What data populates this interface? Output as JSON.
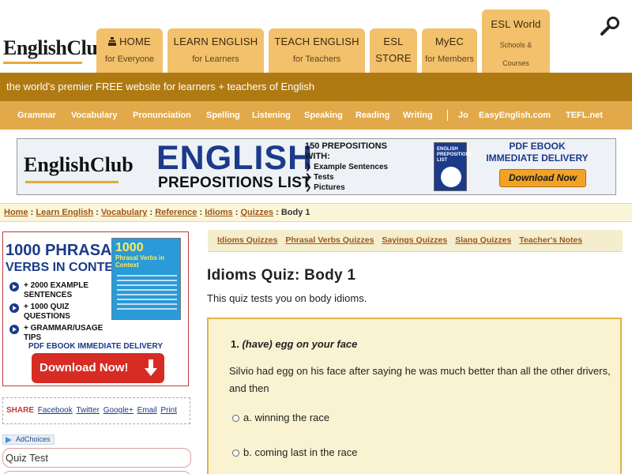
{
  "header": {
    "logo": {
      "english": "English",
      "club": "Club"
    },
    "tabs": [
      {
        "line1": "HOME",
        "line2": "for Everyone"
      },
      {
        "line1": "LEARN ENGLISH",
        "line2": "for Learners"
      },
      {
        "line1": "TEACH ENGLISH",
        "line2": "for Teachers"
      },
      {
        "line1": "ESL",
        "line2": "STORE"
      },
      {
        "line1": "MyEC",
        "line2": "for Members"
      },
      {
        "line1": "ESL World",
        "line2": "Schools &",
        "line3": "Courses"
      }
    ],
    "search_icon": "search-icon",
    "tagline": "the world's premier FREE website for learners + teachers of English",
    "subnav": [
      "Grammar",
      "Vocabulary",
      "Pronunciation",
      "Spelling",
      "Listening",
      "Speaking",
      "Reading",
      "Writing",
      "Jo",
      "EasyEnglish.com",
      "TEFL.net"
    ]
  },
  "banner": {
    "logo": "EnglishClub",
    "title1": "ENGLISH",
    "title2": "PREPOSITIONS LIST",
    "heading1": "150 PREPOSITIONS",
    "heading2": "WITH:",
    "items": [
      "Example Sentences",
      "Tests",
      "Pictures"
    ],
    "book_title": "ENGLISH PREPOSITIONS LIST",
    "pdf_line1": "PDF EBOOK",
    "pdf_line2": "IMMEDIATE DELIVERY",
    "button": "Download Now"
  },
  "breadcrumb": {
    "items": [
      "Home",
      "Learn English",
      "Vocabulary",
      "Reference",
      "Idioms",
      "Quizzes"
    ],
    "separator": ":",
    "current": "Body 1"
  },
  "sidebar": {
    "ad": {
      "title1": "1000 PHRASAL",
      "title2": "VERBS IN CONTEXT",
      "book_title1": "1000",
      "book_title2": "Phrasal Verbs in Context",
      "bullets": [
        "+ 2000 EXAMPLE SENTENCES",
        "+ 1000 QUIZ QUESTIONS",
        "+ GRAMMAR/USAGE TIPS"
      ],
      "pdf": "PDF EBOOK IMMEDIATE DELIVERY",
      "button": "Download Now!"
    },
    "share": {
      "label": "SHARE",
      "links": [
        "Facebook",
        "Twitter",
        "Google+",
        "Email",
        "Print"
      ]
    },
    "adchoices": "AdChoices",
    "quiz_link": "Quiz Test"
  },
  "main": {
    "quiz_links": [
      "Idioms Quizzes",
      "Phrasal Verbs Quizzes",
      "Sayings Quizzes",
      "Slang Quizzes",
      "Teacher's Notes"
    ],
    "title": "Idioms Quiz: Body 1",
    "description": "This quiz tests you on body idioms.",
    "question": {
      "number": "1.",
      "idiom": "(have) egg on your face",
      "text": "Silvio had egg on his face after saying he was much better than all the other drivers, and then",
      "options": [
        "a. winning the race",
        "b. coming last in the race"
      ]
    }
  },
  "colors": {
    "tab": "#f3c06b",
    "tagline_bg": "#b07a13",
    "subnav_bg": "#e1a94a",
    "link": "#a0561a",
    "navy": "#1b3a8a",
    "quiz_bg": "#faf3d2"
  }
}
